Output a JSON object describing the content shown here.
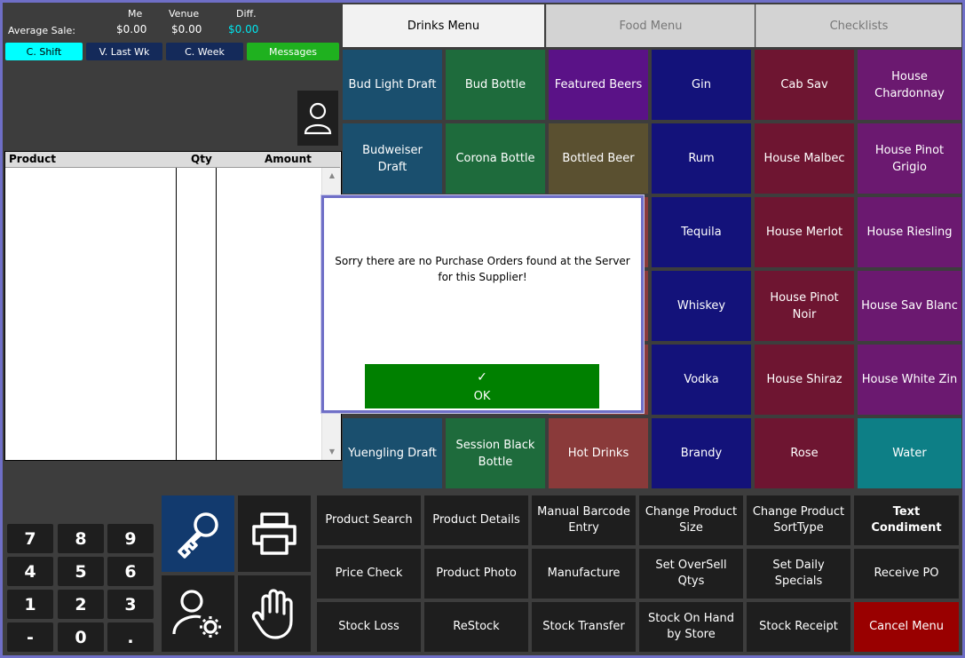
{
  "stats": {
    "average_label": "Average Sale:",
    "col_me": "Me",
    "col_venue": "Venue",
    "col_diff": "Diff.",
    "me_value": "$0.00",
    "venue_value": "$0.00",
    "diff_value": "$0.00"
  },
  "period_buttons": {
    "c_shift": "C. Shift",
    "v_last_wk": "V. Last Wk",
    "c_week": "C. Week",
    "messages": "Messages"
  },
  "product_table": {
    "col_product": "Product",
    "col_qty": "Qty",
    "col_amount": "Amount"
  },
  "menu_tabs": {
    "drinks": "Drinks Menu",
    "food": "Food Menu",
    "checklists": "Checklists"
  },
  "drinks_grid": [
    [
      "Bud Light Draft",
      "Bud Bottle",
      "Featured Beers",
      "Gin",
      "Cab Sav",
      "House Chardonnay"
    ],
    [
      "Budweiser Draft",
      "Corona Bottle",
      "Bottled Beer",
      "Rum",
      "House Malbec",
      "House Pinot Grigio"
    ],
    [
      "",
      "",
      "",
      "Tequila",
      "House Merlot",
      "House Riesling"
    ],
    [
      "",
      "",
      "",
      "Whiskey",
      "House Pinot Noir",
      "House Sav Blanc"
    ],
    [
      "",
      "",
      "",
      "Vodka",
      "House Shiraz",
      "House White Zin"
    ],
    [
      "Yuengling Draft",
      "Session Black Bottle",
      "Hot Drinks",
      "Brandy",
      "Rose",
      "Water"
    ]
  ],
  "colors": {
    "beer_blue": "#1a4f6e",
    "bottle_green": "#1e6b3c",
    "featured_purple": "#5a1287",
    "bottled_olive": "#5a5030",
    "spirit_navy": "#13127a",
    "red_wine": "#6e1531",
    "white_wine": "#6b1970",
    "hot_drinks": "#8a3a3a",
    "water_teal": "#0d7f86",
    "ok_green": "#008000",
    "cancel_red": "#990000",
    "key_blue": "#123a6e",
    "dialog_border": "#6f6fc7"
  },
  "numpad": [
    "7",
    "8",
    "9",
    "4",
    "5",
    "6",
    "1",
    "2",
    "3",
    "-",
    "0",
    "."
  ],
  "icon_buttons": {
    "key": "key-icon",
    "print": "printer-icon",
    "user_settings": "user-settings-icon",
    "hand": "hand-icon",
    "profile": "user-icon"
  },
  "functions": [
    [
      "Product Search",
      "Product Details",
      "Manual Barcode Entry",
      "Change Product Size",
      "Change Product SortType",
      "Text Condiment"
    ],
    [
      "Price Check",
      "Product Photo",
      "Manufacture",
      "Set OverSell Qtys",
      "Set Daily Specials",
      "Receive PO"
    ],
    [
      "Stock Loss",
      "ReStock",
      "Stock Transfer",
      "Stock On Hand by Store",
      "Stock Receipt",
      "Cancel Menu"
    ]
  ],
  "dialog": {
    "message": "Sorry there are no Purchase Orders found at the Server for this Supplier!",
    "ok_check": "✓",
    "ok_label": "OK"
  }
}
